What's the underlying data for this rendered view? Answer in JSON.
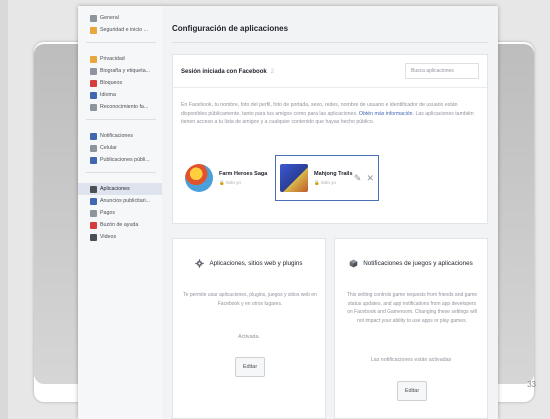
{
  "slide": {
    "number": "33"
  },
  "sidebar": {
    "groups": [
      [
        {
          "label": "General",
          "icon": "gear-icon",
          "color": "#8d949e"
        },
        {
          "label": "Seguridad e inicio ...",
          "icon": "lock-badge-icon",
          "color": "#e8a73a"
        }
      ],
      [
        {
          "label": "Privacidad",
          "icon": "privacy-lock-icon",
          "color": "#e8a73a"
        },
        {
          "label": "Biografía y etiqueta...",
          "icon": "timeline-icon",
          "color": "#8d949e"
        },
        {
          "label": "Bloqueos",
          "icon": "block-icon",
          "color": "#d63c3c"
        },
        {
          "label": "Idioma",
          "icon": "language-icon",
          "color": "#4267b2"
        },
        {
          "label": "Reconocimiento fa...",
          "icon": "face-recognition-icon",
          "color": "#8d949e"
        }
      ],
      [
        {
          "label": "Notificaciones",
          "icon": "globe-icon",
          "color": "#4267b2"
        },
        {
          "label": "Celular",
          "icon": "mobile-icon",
          "color": "#8d949e"
        },
        {
          "label": "Publicaciones públi...",
          "icon": "public-posts-icon",
          "color": "#4267b2"
        }
      ],
      [
        {
          "label": "Aplicaciones",
          "icon": "apps-icon",
          "color": "#4b4f56",
          "active": true
        },
        {
          "label": "Anuncios publicitari...",
          "icon": "ads-icon",
          "color": "#4267b2"
        },
        {
          "label": "Pagos",
          "icon": "payments-icon",
          "color": "#8d949e"
        },
        {
          "label": "Buzón de ayuda",
          "icon": "help-inbox-icon",
          "color": "#d63c3c"
        },
        {
          "label": "Videos",
          "icon": "video-icon",
          "color": "#4b4f56"
        }
      ]
    ]
  },
  "main": {
    "title": "Configuración de aplicaciones",
    "session": {
      "title": "Sesión iniciada con Facebook",
      "count": "2",
      "search_placeholder": "Busca aplicaciones",
      "desc_pre": "En Facebook, tu nombre, foto del perfil, foto de portada, sexo, redes, nombre de usuario e identificador de usuario están disponibles públicamente, tanto para tus amigos como para las aplicaciones. ",
      "desc_link": "Obtén más información",
      "desc_post": ". Las aplicaciones también tienen acceso a tu lista de amigos y a cualquier contenido que hayas hecho público.",
      "apps": [
        {
          "name": "Farm Heroes Saga",
          "visibility": "Solo yo"
        },
        {
          "name": "Mahjong Trails",
          "visibility": "Solo yo"
        }
      ],
      "edit_glyph": "✎",
      "close_glyph": "✕"
    },
    "apps_card": {
      "title": "Aplicaciones, sitios web y plugins",
      "desc": "Te permite usar aplicaciones, plugins, juegos y sitios web en Facebook y en otros lugares.",
      "status": "Activada.",
      "button": "Editar"
    },
    "games_card": {
      "title": "Notificaciones de juegos y aplicaciones",
      "desc": "This setting controls game requests from friends and game status updates, and app notifications from app developers on Facebook and Gameroom. Changing these settings will not impact your ability to use apps or play games.",
      "status": "Las notificaciones están activadas",
      "button": "Editar"
    }
  }
}
